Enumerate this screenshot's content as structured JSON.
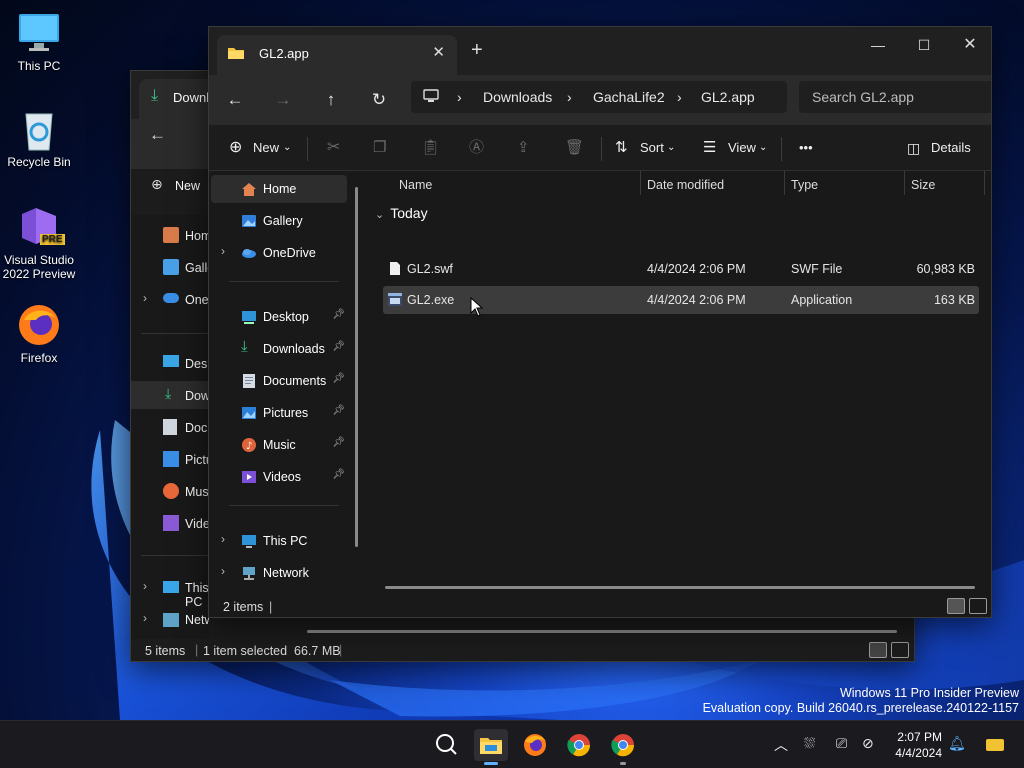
{
  "desktop": {
    "icons": [
      {
        "label": "This PC"
      },
      {
        "label": "Recycle Bin"
      },
      {
        "label": "Visual Studio 2022 Preview",
        "badge": "PRE"
      },
      {
        "label": "Firefox"
      }
    ],
    "watermark": {
      "line1": "Windows 11 Pro Insider Preview",
      "line2": "Evaluation copy. Build 26040.rs_prerelease.240122-1157"
    }
  },
  "back_window": {
    "tab_title": "Downloads",
    "new_label": "New",
    "nav": [
      {
        "label": "Home"
      },
      {
        "label": "Gallery"
      },
      {
        "label": "OneDrive"
      },
      {
        "label": "Desktop"
      },
      {
        "label": "Downloads"
      },
      {
        "label": "Documents"
      },
      {
        "label": "Pictures"
      },
      {
        "label": "Music"
      },
      {
        "label": "Videos"
      },
      {
        "label": "This PC"
      },
      {
        "label": "Network"
      }
    ],
    "status": {
      "count": "5 items",
      "selected": "1 item selected  66.7 MB"
    }
  },
  "window": {
    "tab_title": "GL2.app",
    "breadcrumb": [
      "Downloads",
      "GachaLife2",
      "GL2.app"
    ],
    "search_placeholder": "Search GL2.app",
    "toolbar": {
      "new": "New",
      "sort": "Sort",
      "view": "View",
      "more": "•••",
      "details": "Details"
    },
    "nav": [
      {
        "label": "Home"
      },
      {
        "label": "Gallery"
      },
      {
        "label": "OneDrive"
      },
      {
        "label": "Desktop"
      },
      {
        "label": "Downloads"
      },
      {
        "label": "Documents"
      },
      {
        "label": "Pictures"
      },
      {
        "label": "Music"
      },
      {
        "label": "Videos"
      },
      {
        "label": "This PC"
      },
      {
        "label": "Network"
      }
    ],
    "columns": {
      "name": "Name",
      "date": "Date modified",
      "type": "Type",
      "size": "Size"
    },
    "group": "Today",
    "files": [
      {
        "name": "GL2.swf",
        "date": "4/4/2024 2:06 PM",
        "type": "SWF File",
        "size": "60,983 KB"
      },
      {
        "name": "GL2.exe",
        "date": "4/4/2024 2:06 PM",
        "type": "Application",
        "size": "163 KB"
      }
    ],
    "status": {
      "count": "2 items"
    }
  },
  "taskbar": {
    "time": "2:07 PM",
    "date": "4/4/2024"
  },
  "colors": {
    "accent_folder": "#f4c542",
    "selected_row": "#3c3c3c",
    "window_bg": "#191919"
  }
}
